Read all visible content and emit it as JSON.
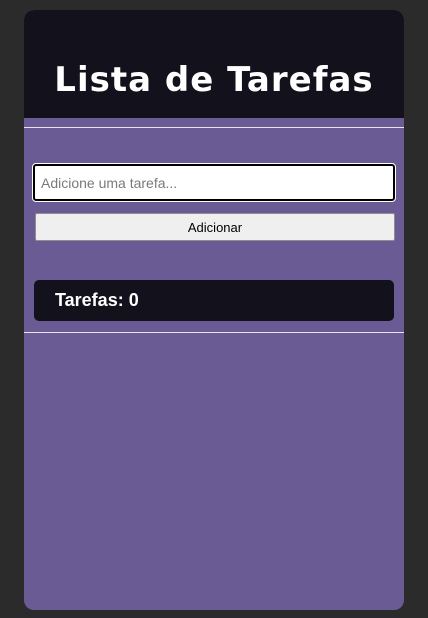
{
  "app": {
    "title": "Lista de Tarefas"
  },
  "form": {
    "input_value": "",
    "input_placeholder": "Adicione uma tarefa...",
    "add_label": "Adicionar"
  },
  "summary": {
    "label": "Tarefas: 0"
  },
  "colors": {
    "page_background": "#2b2b2b",
    "card_background": "#6b5b95",
    "header_background": "#13111c",
    "counter_background": "#13111c",
    "text_light": "#ffffff"
  }
}
